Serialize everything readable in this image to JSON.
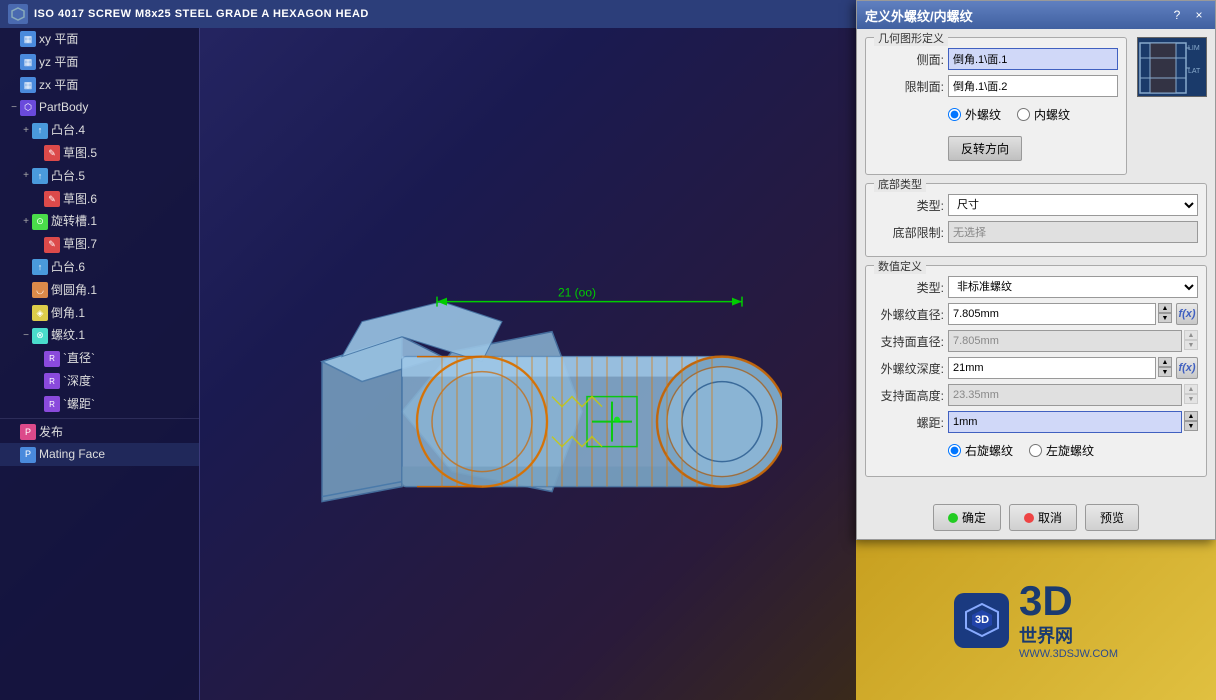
{
  "title": {
    "text": "ISO 4017 SCREW M8x25 STEEL GRADE A HEXAGON HEAD",
    "icon": "●"
  },
  "sidebar": {
    "items": [
      {
        "id": "xy",
        "label": "xy 平面",
        "icon": "▦",
        "type": "plane",
        "indent": 1,
        "expand": ""
      },
      {
        "id": "yz",
        "label": "yz 平面",
        "icon": "▦",
        "type": "plane",
        "indent": 1,
        "expand": ""
      },
      {
        "id": "zx",
        "label": "zx 平面",
        "icon": "▦",
        "type": "plane",
        "indent": 1,
        "expand": ""
      },
      {
        "id": "partbody",
        "label": "PartBody",
        "icon": "⬡",
        "type": "body",
        "indent": 1,
        "expand": "−"
      },
      {
        "id": "boss4",
        "label": "凸台.4",
        "icon": "↑",
        "type": "boss",
        "indent": 2,
        "expand": "+"
      },
      {
        "id": "sketch5",
        "label": "草图.5",
        "icon": "✎",
        "type": "sketch",
        "indent": 3,
        "expand": ""
      },
      {
        "id": "boss5",
        "label": "凸台.5",
        "icon": "↑",
        "type": "boss",
        "indent": 2,
        "expand": "+"
      },
      {
        "id": "sketch6",
        "label": "草图.6",
        "icon": "✎",
        "type": "sketch",
        "indent": 3,
        "expand": ""
      },
      {
        "id": "groove1",
        "label": "旋转槽.1",
        "icon": "⊙",
        "type": "groove",
        "indent": 2,
        "expand": "+"
      },
      {
        "id": "sketch7",
        "label": "草图.7",
        "icon": "✎",
        "type": "sketch",
        "indent": 3,
        "expand": ""
      },
      {
        "id": "boss6",
        "label": "凸台.6",
        "icon": "↑",
        "type": "boss",
        "indent": 2,
        "expand": ""
      },
      {
        "id": "fillet1",
        "label": "倒圆角.1",
        "icon": "◡",
        "type": "fillet",
        "indent": 2,
        "expand": ""
      },
      {
        "id": "chamfer1",
        "label": "倒角.1",
        "icon": "◈",
        "type": "chamfer",
        "indent": 2,
        "expand": ""
      },
      {
        "id": "thread1",
        "label": "螺纹.1",
        "icon": "⊗",
        "type": "thread",
        "indent": 2,
        "expand": "−"
      },
      {
        "id": "diam",
        "label": "`直径`",
        "icon": "R",
        "type": "param",
        "indent": 3,
        "expand": ""
      },
      {
        "id": "depth",
        "label": "`深度`",
        "icon": "R",
        "type": "param",
        "indent": 3,
        "expand": ""
      },
      {
        "id": "pitch",
        "label": "`螺距`",
        "icon": "R",
        "type": "param",
        "indent": 3,
        "expand": ""
      },
      {
        "id": "publish",
        "label": "发布",
        "icon": "P",
        "type": "publish",
        "indent": 1,
        "expand": ""
      },
      {
        "id": "matingface",
        "label": "Mating Face",
        "icon": "P",
        "type": "mating",
        "indent": 1,
        "expand": ""
      }
    ]
  },
  "dialog": {
    "title": "定义外螺纹/内螺纹",
    "help_btn": "?",
    "close_btn": "×",
    "sections": {
      "geometry": {
        "label": "几何图形定义",
        "lateral_label": "侧面:",
        "lateral_value": "倒角.1\\面.1",
        "limit_label": "限制面:",
        "limit_value": "倒角.1\\面.2",
        "thread_type_external": "外螺纹",
        "thread_type_internal": "内螺纹",
        "reverse_btn": "反转方向"
      },
      "bottom": {
        "label": "底部类型",
        "type_label": "类型:",
        "type_value": "尺寸",
        "limit_label": "底部限制:",
        "limit_value": "无选择"
      },
      "numeric": {
        "label": "数值定义",
        "type_label": "类型:",
        "type_value": "非标准螺纹",
        "outer_diam_label": "外螺纹直径:",
        "outer_diam_value": "7.805mm",
        "support_diam_label": "支持面直径:",
        "support_diam_value": "7.805mm",
        "outer_depth_label": "外螺纹深度:",
        "outer_depth_value": "21mm",
        "support_height_label": "支持面高度:",
        "support_height_value": "23.35mm",
        "pitch_label": "螺距:",
        "pitch_value": "1mm",
        "right_hand": "右旋螺纹",
        "left_hand": "左旋螺纹"
      }
    },
    "footer": {
      "ok_label": "确定",
      "cancel_label": "取消",
      "preview_label": "预览"
    },
    "schema_labels": {
      "lim": "LIM",
      "lat": "LAT"
    }
  },
  "logo": {
    "main": "3D",
    "sub": "世界网",
    "url": "WWW.3DSJW.COM"
  },
  "dimension": {
    "value": "21 (oo)"
  }
}
